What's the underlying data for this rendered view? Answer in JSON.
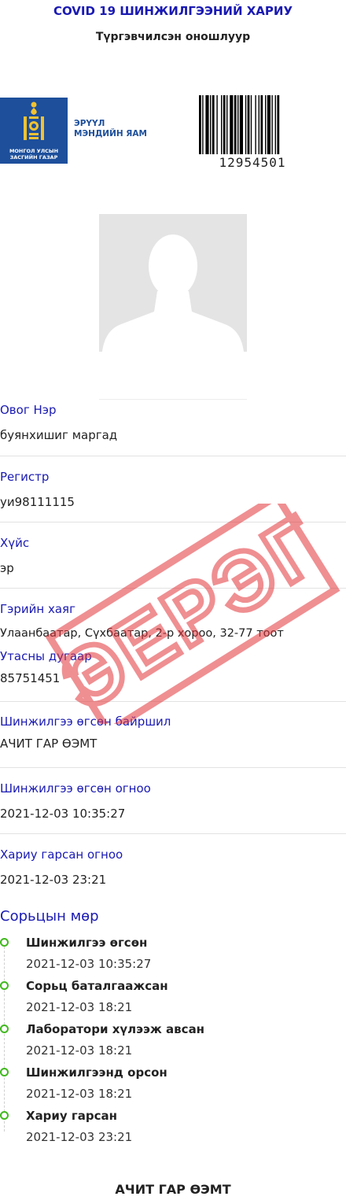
{
  "header": {
    "title": "COVID 19 ШИНЖИЛГЭЭНИЙ ХАРИУ",
    "subtitle": "Түргэвчилсэн оношлуур"
  },
  "logo": {
    "emblem_text_line1": "МОНГОЛ УЛСЫН",
    "emblem_text_line2": "ЗАСГИЙН ГАЗАР",
    "ministry_line1": "ЭРҮҮЛ",
    "ministry_line2": "МЭНДИЙН ЯАМ",
    "brand_color": "#1d4f9b"
  },
  "barcode": {
    "number": "12954501"
  },
  "photo": {
    "icon": "user-silhouette-icon"
  },
  "fields": {
    "name": {
      "label": "Овог Нэр",
      "value": "буянхишиг маргад"
    },
    "register": {
      "label": "Регистр",
      "value": "уи98111115"
    },
    "gender": {
      "label": "Хүйс",
      "value": "эр"
    },
    "address": {
      "label": "Гэрийн хаяг",
      "value": "Улаанбаатар, Сүхбаатар, 2-р хороо, 32-77 тоот"
    },
    "phone": {
      "label": "Утасны дугаар",
      "value": "85751451"
    },
    "location": {
      "label": "Шинжилгээ өгсөн байршил",
      "value": "АЧИТ ГАР ӨЭМТ"
    },
    "test_date": {
      "label": "Шинжилгээ өгсөн огноо",
      "value": "2021-12-03 10:35:27"
    },
    "result_date": {
      "label": "Хариу гарсан огноо",
      "value": "2021-12-03 23:21"
    }
  },
  "timeline": {
    "title": "Сорьцын мөр",
    "accent_color": "#41b81f",
    "items": [
      {
        "title": "Шинжилгээ өгсөн",
        "time": "2021-12-03 10:35:27"
      },
      {
        "title": "Сорьц баталгаажсан",
        "time": "2021-12-03 18:21"
      },
      {
        "title": "Лаборатори хүлээж авсан",
        "time": "2021-12-03 18:21"
      },
      {
        "title": "Шинжилгээнд орсон",
        "time": "2021-12-03 18:21"
      },
      {
        "title": "Хариу гарсан",
        "time": "2021-12-03 23:21"
      }
    ]
  },
  "stamp": {
    "text": "ЭЕРЭГ",
    "color": "#e3343a"
  },
  "footer": {
    "text": "АЧИТ ГАР ӨЭМТ"
  }
}
